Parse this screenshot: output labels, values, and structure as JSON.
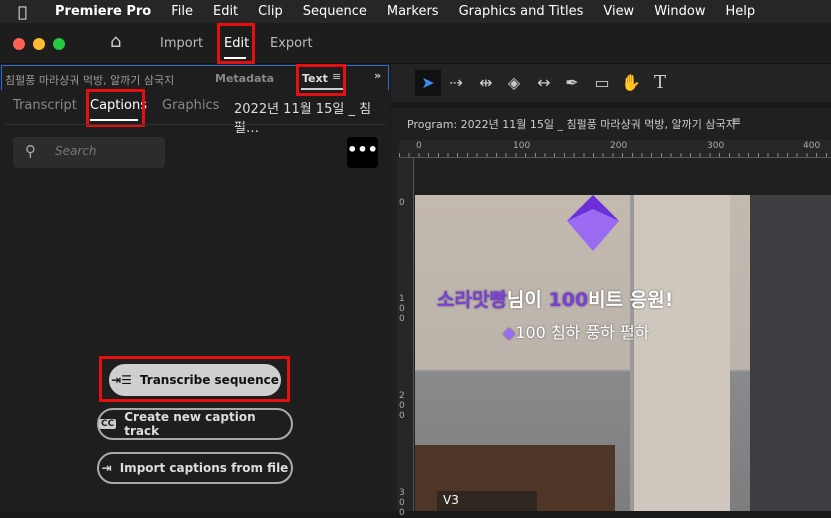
{
  "menubar": {
    "apple": "",
    "app": "Premiere Pro",
    "items": [
      "File",
      "Edit",
      "Clip",
      "Sequence",
      "Markers",
      "Graphics and Titles",
      "View",
      "Window",
      "Help"
    ]
  },
  "workspace": {
    "home": "⌂",
    "tabs": [
      "Import",
      "Edit",
      "Export"
    ]
  },
  "left_panel": {
    "title": "침펄풍 마라샹궈 먹방, 알까기 삼국지",
    "metadata": "Metadata",
    "text": "Text",
    "tabs": [
      "Transcript",
      "Captions",
      "Graphics",
      "2022년 11월 15일 _ 침펄…"
    ],
    "search_placeholder": "Search",
    "more": "•••",
    "buttons": {
      "transcribe": "Transcribe sequence",
      "create": "Create new caption track",
      "import": "Import captions from file"
    }
  },
  "program": {
    "title": "Program: 2022년 11월 15일 _ 침펄풍 마라샹궈 먹방, 알까기 삼국지",
    "ruler_h": [
      "0",
      "100",
      "200",
      "300",
      "400"
    ],
    "ruler_v": [
      "0",
      "100",
      "200",
      "300"
    ],
    "track": "V3"
  },
  "video": {
    "line1_name": "소라맛빵",
    "line1_mid": "님이 ",
    "line1_num": "100",
    "line1_end": "비트 응원!",
    "line2": "100 침하 풍하 펄하"
  },
  "colors": {
    "accent": "#2d6fd0",
    "highlight": "#e41010",
    "purple": "#7a3fd6"
  }
}
